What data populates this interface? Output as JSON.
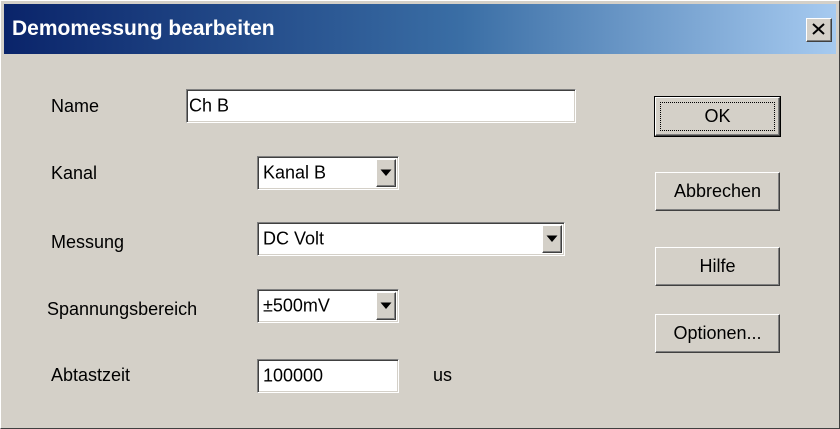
{
  "window": {
    "title": "Demomessung bearbeiten",
    "close_label": "X"
  },
  "form": {
    "name": {
      "label": "Name",
      "value": "Ch B"
    },
    "kanal": {
      "label": "Kanal",
      "value": "Kanal B"
    },
    "messung": {
      "label": "Messung",
      "value": "DC Volt"
    },
    "spannungsbereich": {
      "label": "Spannungsbereich",
      "value": "±500mV"
    },
    "abtastzeit": {
      "label": "Abtastzeit",
      "value": "100000",
      "unit": "us"
    }
  },
  "buttons": {
    "ok": "OK",
    "cancel": "Abbrechen",
    "help": "Hilfe",
    "options": "Optionen..."
  },
  "colors": {
    "title_gradient_start": "#0a246a",
    "title_gradient_end": "#a6caf0",
    "dialog_background": "#d4d0c8"
  },
  "icons": {
    "close": "close-icon",
    "dropdown": "chevron-down-icon"
  }
}
